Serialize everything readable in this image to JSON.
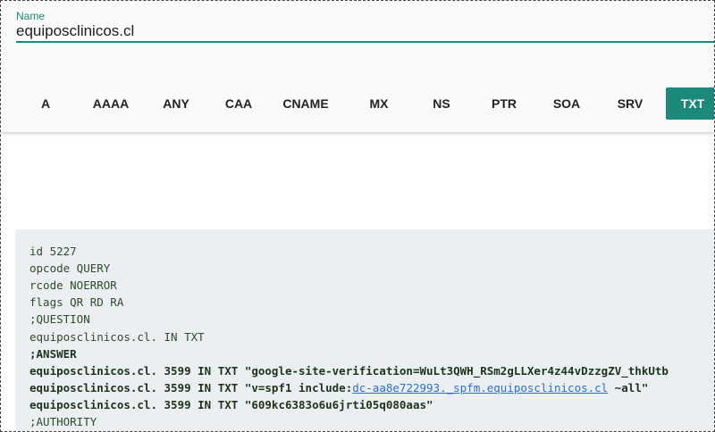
{
  "form": {
    "name_label": "Name",
    "name_value": "equiposclinicos.cl"
  },
  "record_types": [
    "A",
    "AAAA",
    "ANY",
    "CAA",
    "CNAME",
    "MX",
    "NS",
    "PTR",
    "SOA",
    "SRV",
    "TXT"
  ],
  "active_record_type": "TXT",
  "colors": {
    "accent": "#1b8a7a",
    "link": "#2a6fd6",
    "panel": "#eceff1"
  },
  "response": {
    "id_line": "id 5227",
    "opcode_line": "opcode QUERY",
    "rcode_line": "rcode NOERROR",
    "flags_line": "flags QR RD RA",
    "question_header": ";QUESTION",
    "question_line": "equiposclinicos.cl. IN TXT",
    "answer_header": ";ANSWER",
    "answer_1": "equiposclinicos.cl. 3599 IN TXT \"google-site-verification=WuLt3QWH_RSm2gLLXer4z44vDzzgZV_thkUtb",
    "answer_2_prefix": "equiposclinicos.cl. 3599 IN TXT \"v=spf1 include:",
    "answer_2_link": "dc-aa8e722993._spfm.equiposclinicos.cl",
    "answer_2_suffix": " ~all\"",
    "answer_3": "equiposclinicos.cl. 3599 IN TXT \"609kc6383o6u6jrti05q080aas\"",
    "authority_header": ";AUTHORITY"
  }
}
